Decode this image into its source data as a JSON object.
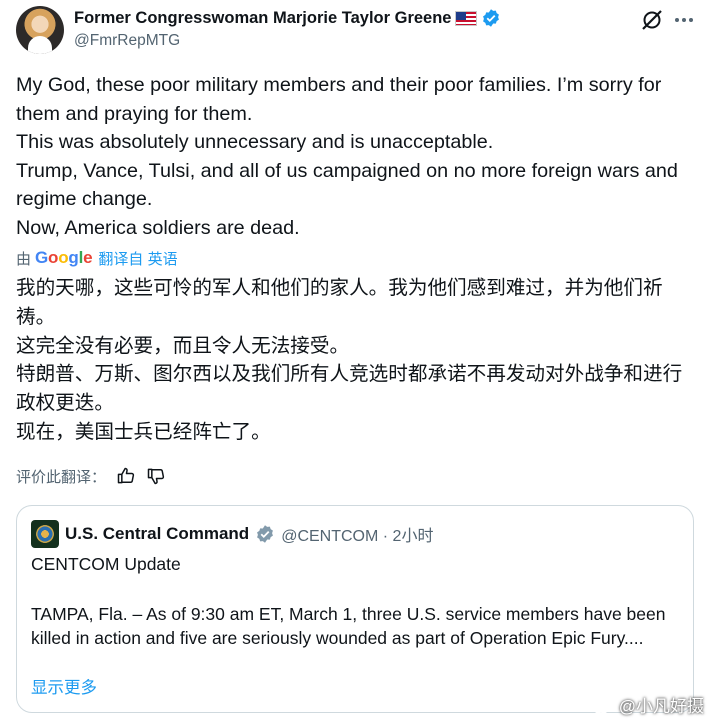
{
  "author": {
    "display_name": "Former Congresswoman Marjorie Taylor Greene",
    "handle": "@FmrRepMTG",
    "icons": [
      "avatar",
      "us-flag-icon",
      "verified-badge-icon",
      "grok-icon",
      "more-icon"
    ]
  },
  "tweet": {
    "lines": [
      "My God, these poor military members and their poor families. I’m sorry for them and praying for them.",
      "This was absolutely unnecessary and is unacceptable.",
      "Trump, Vance, Tulsi, and all of us campaigned on no more foreign wars and regime change.",
      "Now, America soldiers are dead."
    ]
  },
  "translation": {
    "prefix": "由",
    "provider": "Google",
    "link_label": "翻译自 英语",
    "lines": [
      "我的天哪，这些可怜的军人和他们的家人。我为他们感到难过，并为他们祈祷。",
      "这完全没有必要，而且令人无法接受。",
      "特朗普、万斯、图尔西以及我们所有人竞选时都承诺不再发动对外战争和进行政权更迭。",
      "现在，美国士兵已经阵亡了。"
    ],
    "rate_label": "评价此翻译："
  },
  "quote": {
    "name": "U.S. Central Command",
    "handle_time": "@CENTCOM · 2小时",
    "title": "CENTCOM Update",
    "body": "TAMPA, Fla. – As of 9:30 am ET, March 1, three U.S. service members have been killed in action and five are seriously wounded as part of Operation Epic Fury....",
    "show_more": "显示更多"
  },
  "watermark": {
    "text": "@小凡好摄"
  },
  "colors": {
    "text": "#0f1419",
    "secondary": "#536471",
    "link": "#1d9bf0",
    "border": "#cfd9de"
  }
}
